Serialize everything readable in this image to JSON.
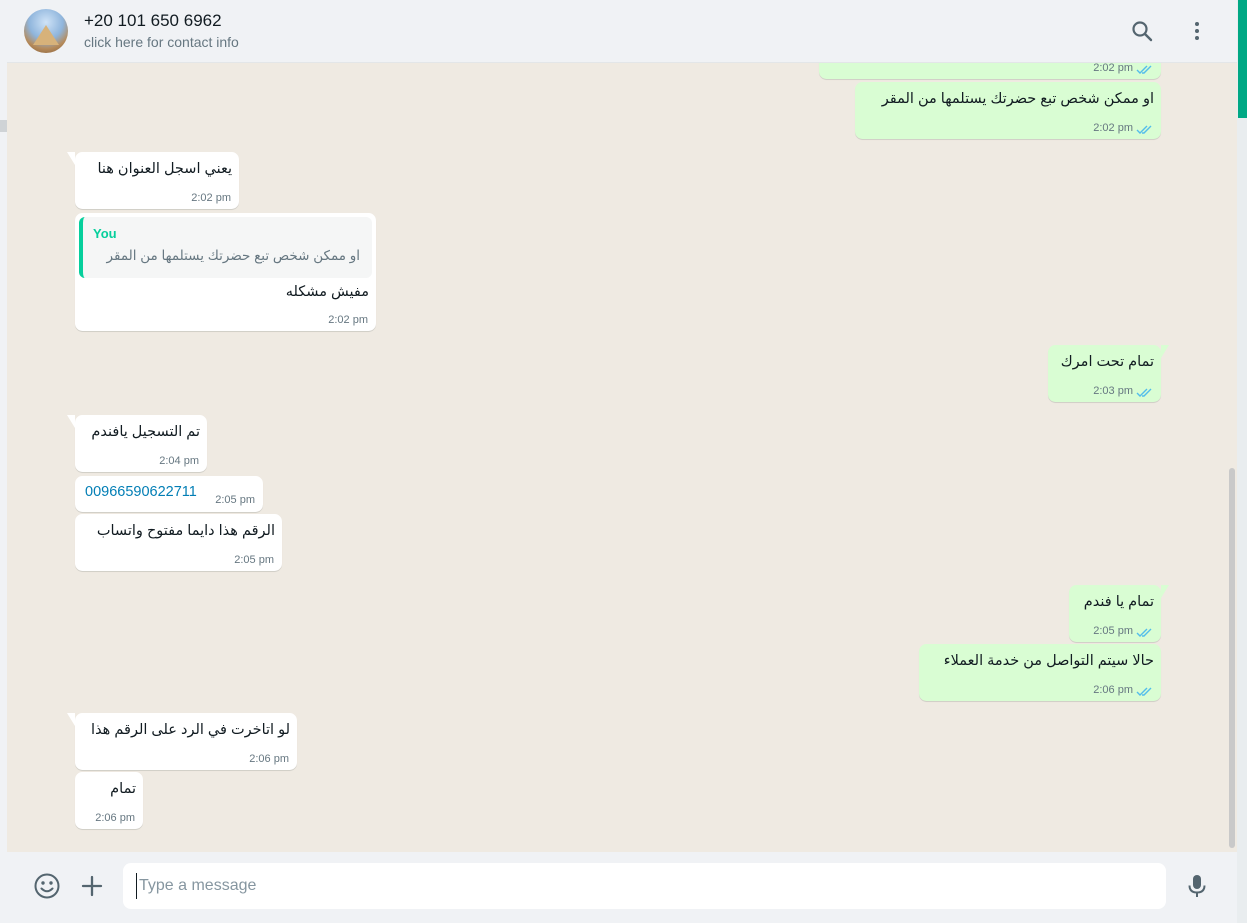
{
  "header": {
    "contact_name": "+20 101 650 6962",
    "contact_subtitle": "click here for contact info",
    "icons": [
      "search-icon",
      "menu-icon"
    ]
  },
  "messages": [
    {
      "dir": "out",
      "text": "",
      "time": "2:02 pm",
      "ticks": "read"
    },
    {
      "dir": "out",
      "text": "او ممكن شخص تبع حضرتك يستلمها من المقر",
      "time": "2:02 pm",
      "ticks": "read"
    },
    {
      "dir": "in",
      "text": "يعني اسجل العنوان هنا",
      "time": "2:02 pm"
    },
    {
      "dir": "in",
      "quote_author": "You",
      "quote_text": "او ممكن شخص تبع حضرتك يستلمها من المقر",
      "text": "مفيش مشكله",
      "time": "2:02 pm"
    },
    {
      "dir": "out",
      "text": "تمام تحت امرك",
      "time": "2:03 pm",
      "ticks": "read"
    },
    {
      "dir": "in",
      "text": "تم التسجيل يافندم",
      "time": "2:04 pm"
    },
    {
      "dir": "in",
      "text": "00966590622711",
      "time": "2:05 pm",
      "is_link": true
    },
    {
      "dir": "in",
      "text": "الرقم هذا دايما مفتوح واتساب",
      "time": "2:05 pm"
    },
    {
      "dir": "out",
      "text": "تمام يا فندم",
      "time": "2:05 pm",
      "ticks": "read"
    },
    {
      "dir": "out",
      "text": "حالا سيتم التواصل من خدمة العملاء",
      "time": "2:06 pm",
      "ticks": "read"
    },
    {
      "dir": "in",
      "text": "لو اتاخرت في الرد على الرقم هذا",
      "time": "2:06 pm"
    },
    {
      "dir": "in",
      "text": "تمام",
      "time": "2:06 pm"
    }
  ],
  "composer": {
    "placeholder": "Type a message",
    "value": "",
    "icons": [
      "emoji-icon",
      "attach-plus-icon",
      "microphone-icon"
    ]
  },
  "colors": {
    "chat_bg": "#efeae2",
    "incoming_bubble": "#ffffff",
    "outgoing_bubble": "#d9fdd3",
    "read_ticks": "#53bdeb",
    "accent": "#00a884",
    "link": "#027eb5"
  }
}
